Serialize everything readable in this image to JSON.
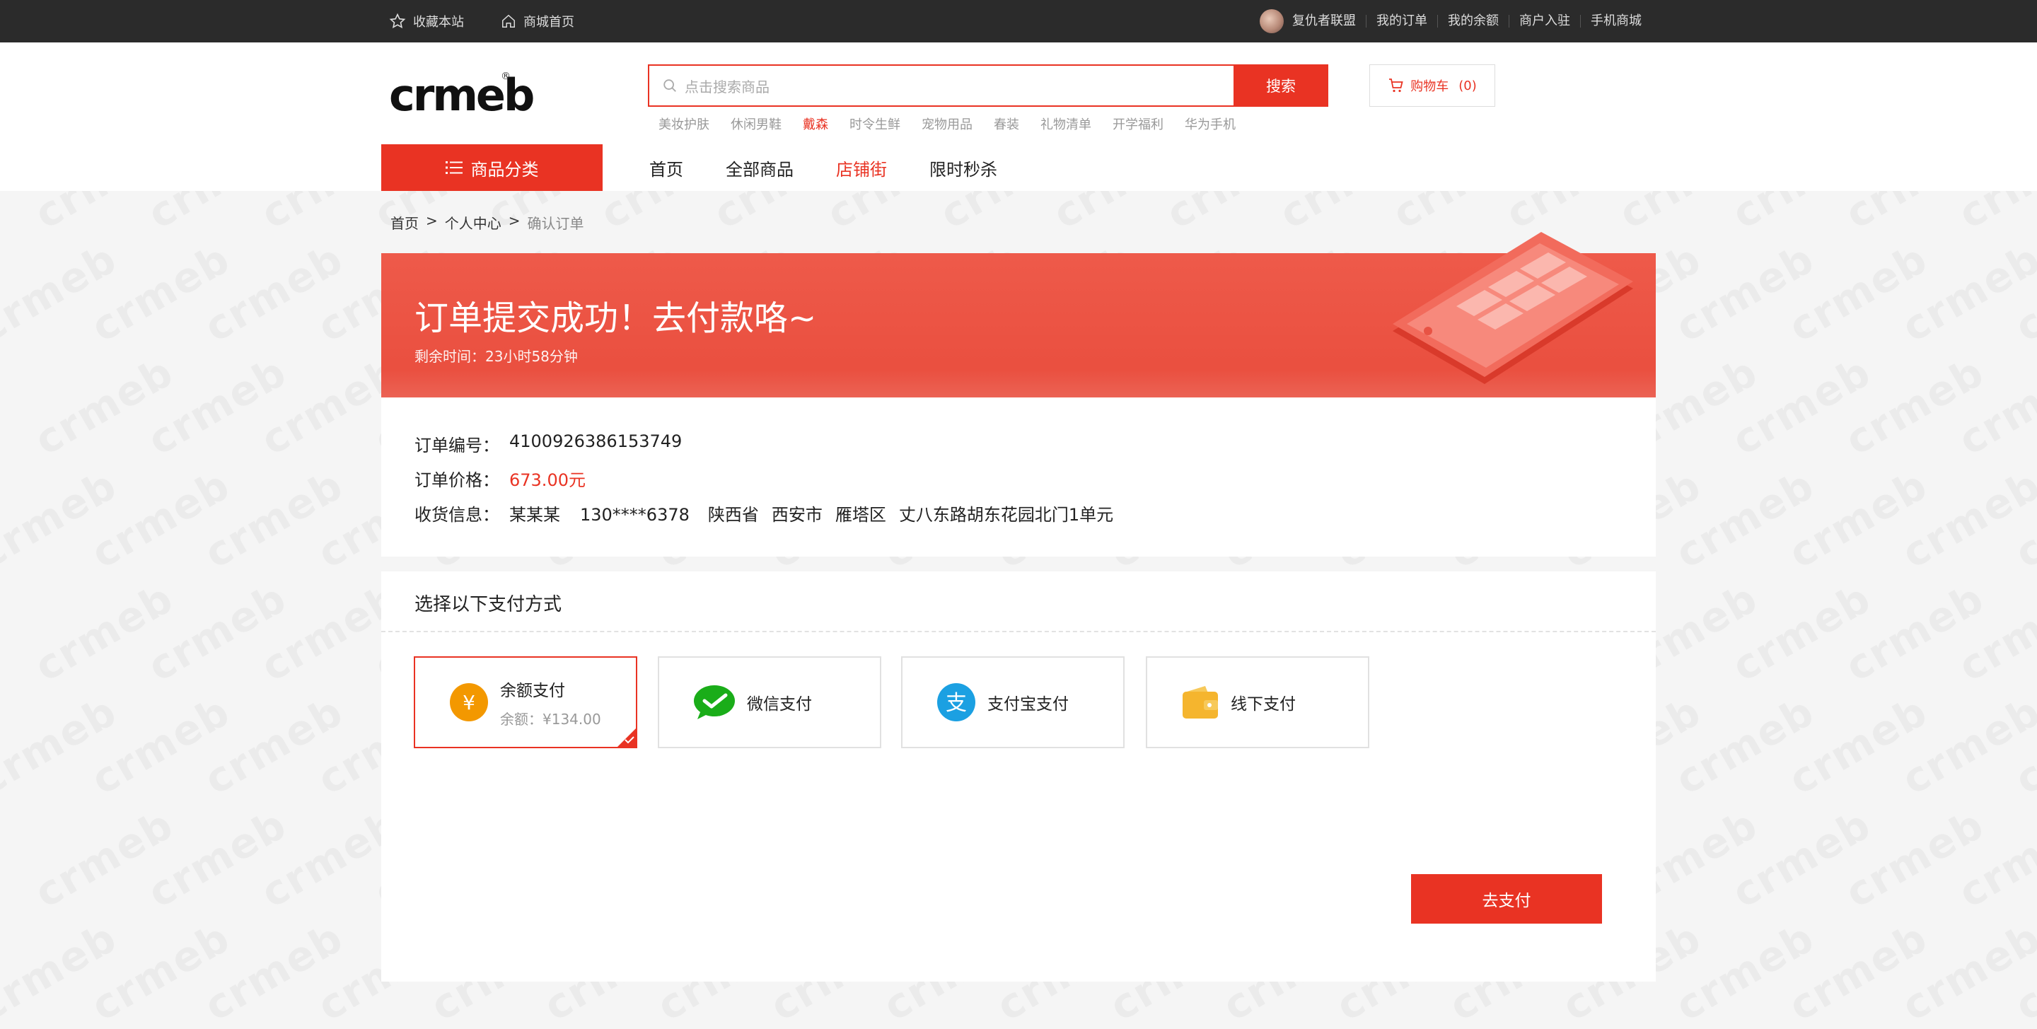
{
  "topbar": {
    "favorite": "收藏本站",
    "home": "商城首页",
    "username": "复仇者联盟",
    "links": [
      "我的订单",
      "我的余额",
      "商户入驻",
      "手机商城"
    ]
  },
  "logo": {
    "text": "crmeb",
    "reg": "®"
  },
  "search": {
    "placeholder": "点击搜索商品",
    "button": "搜索"
  },
  "hotwords": [
    {
      "text": "美妆护肤",
      "hot": false
    },
    {
      "text": "休闲男鞋",
      "hot": false
    },
    {
      "text": "戴森",
      "hot": true
    },
    {
      "text": "时令生鲜",
      "hot": false
    },
    {
      "text": "宠物用品",
      "hot": false
    },
    {
      "text": "春装",
      "hot": false
    },
    {
      "text": "礼物清单",
      "hot": false
    },
    {
      "text": "开学福利",
      "hot": false
    },
    {
      "text": "华为手机",
      "hot": false
    }
  ],
  "cart": {
    "label": "购物车",
    "count": "(0)"
  },
  "nav": {
    "category": "商品分类",
    "links": [
      "首页",
      "全部商品",
      "店铺街",
      "限时秒杀"
    ],
    "active_index": 2
  },
  "breadcrumb": [
    "首页",
    "个人中心",
    "确认订单"
  ],
  "banner": {
    "title": "订单提交成功！去付款咯~",
    "remaining": "剩余时间：23小时58分钟"
  },
  "order": {
    "number_label": "订单编号：",
    "number": "4100926386153749",
    "price_label": "订单价格：",
    "price": "673.00元",
    "address_label": "收货信息：",
    "address_parts": [
      "某某某",
      "130****6378",
      "陕西省",
      "西安市",
      "雁塔区",
      "丈八东路胡东花园北门1单元"
    ]
  },
  "payment": {
    "title": "选择以下支付方式",
    "options": [
      {
        "label": "余额支付",
        "sub": "余额：¥134.00",
        "icon": "balance-icon",
        "selected": true
      },
      {
        "label": "微信支付",
        "sub": "",
        "icon": "wechat-icon",
        "selected": false
      },
      {
        "label": "支付宝支付",
        "sub": "",
        "icon": "alipay-icon",
        "selected": false
      },
      {
        "label": "线下支付",
        "sub": "",
        "icon": "wallet-icon",
        "selected": false
      }
    ],
    "button": "去支付"
  },
  "colors": {
    "accent": "#e93323",
    "topbar": "#2b2b2b",
    "balance_icon": "#f39800",
    "wechat_icon": "#1aad19",
    "alipay_icon": "#1ba0e2",
    "wallet_icon": "#f5b52e"
  }
}
